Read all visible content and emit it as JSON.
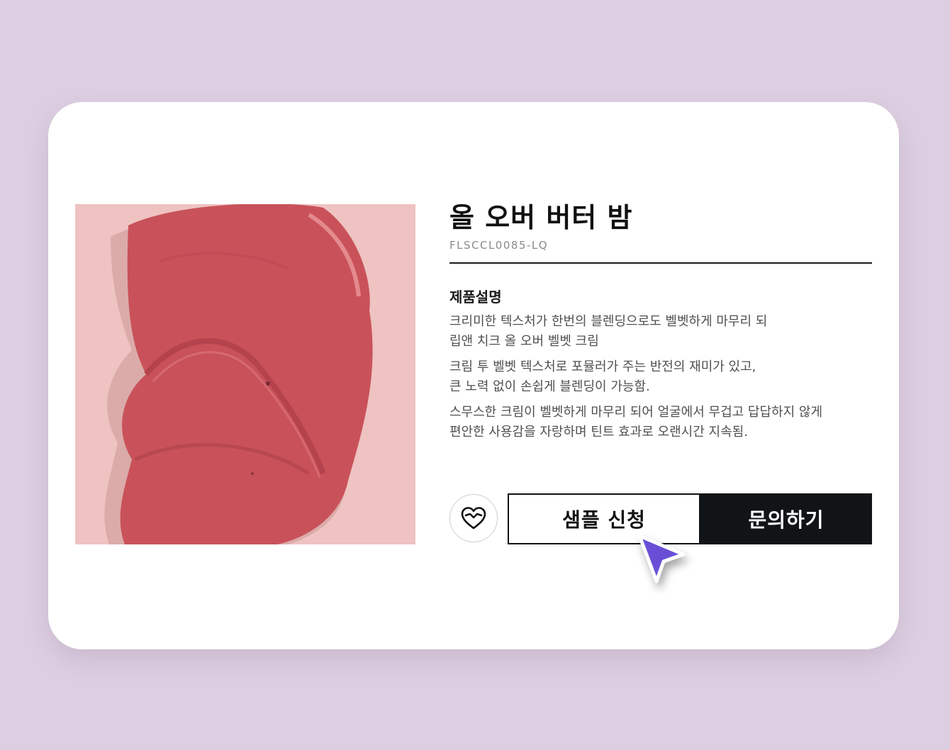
{
  "product": {
    "name": "올 오버 버터 밤",
    "sku": "FLSCCL0085-LQ",
    "image_alt": "product swatch"
  },
  "description": {
    "heading": "제품설명",
    "paragraphs": [
      "크리미한 텍스처가 한번의 블렌딩으로도 벨벳하게 마무리 되\n립앤 치크 올 오버 벨벳 크림",
      "크림 투 벨벳 텍스처로 포뮬러가 주는 반전의 재미가 있고,\n큰 노력 없이 손쉽게 블렌딩이 가능함.",
      "스무스한 크림이 벨벳하게 마무리 되어 얼굴에서 무겁고 답답하지 않게\n편안한 사용감을 자랑하며 틴트 효과로 오랜시간 지속됨."
    ]
  },
  "actions": {
    "sample_label": "샘플 신청",
    "inquiry_label": "문의하기",
    "wishlist_icon": "heart-icon"
  },
  "colors": {
    "background": "#ddcfe1",
    "card": "#ffffff",
    "swatch": "#c9525a",
    "swatch_bg": "#eec3c1",
    "inquiry_button": "#111417",
    "cursor": "#6a4fd6"
  }
}
